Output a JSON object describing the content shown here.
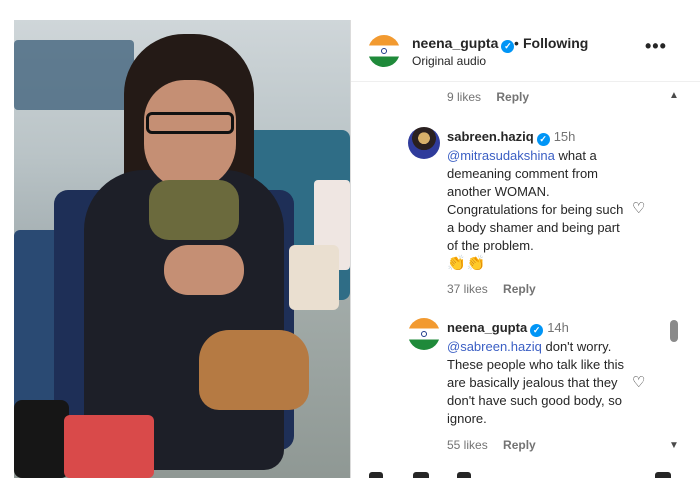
{
  "header": {
    "username": "neena_gupta",
    "separator": "•",
    "follow_state": "Following",
    "audio_label": "Original audio",
    "more_label": "•••"
  },
  "icons": {
    "verified": "verified-badge-icon",
    "heart": "heart-icon",
    "more": "more-options-icon",
    "scroll_up": "chevron-up-icon",
    "scroll_down": "chevron-down-icon"
  },
  "colors": {
    "verified": "#0095f6",
    "mention": "#3b5fc4",
    "meta": "#737373"
  },
  "comments": [
    {
      "likes": "9 likes",
      "reply": "Reply"
    },
    {
      "username": "sabreen.haziq",
      "time": "15h",
      "mention": "@mitrasudakshina",
      "text": " what a demeaning comment from another WOMAN. Congratulations for being such a body shamer and being part of the problem.",
      "emoji": "👏👏",
      "likes": "37 likes",
      "reply": "Reply"
    },
    {
      "username": "neena_gupta",
      "time": "14h",
      "mention": "@sabreen.haziq",
      "text": " don't worry. These people who talk like this are basically jealous that they don't have such good body, so ignore.",
      "likes": "55 likes",
      "reply": "Reply"
    }
  ],
  "scroll_up_glyph": "▲",
  "scroll_down_glyph": "▼",
  "heart_glyph": "♡",
  "verified_glyph": "✓"
}
